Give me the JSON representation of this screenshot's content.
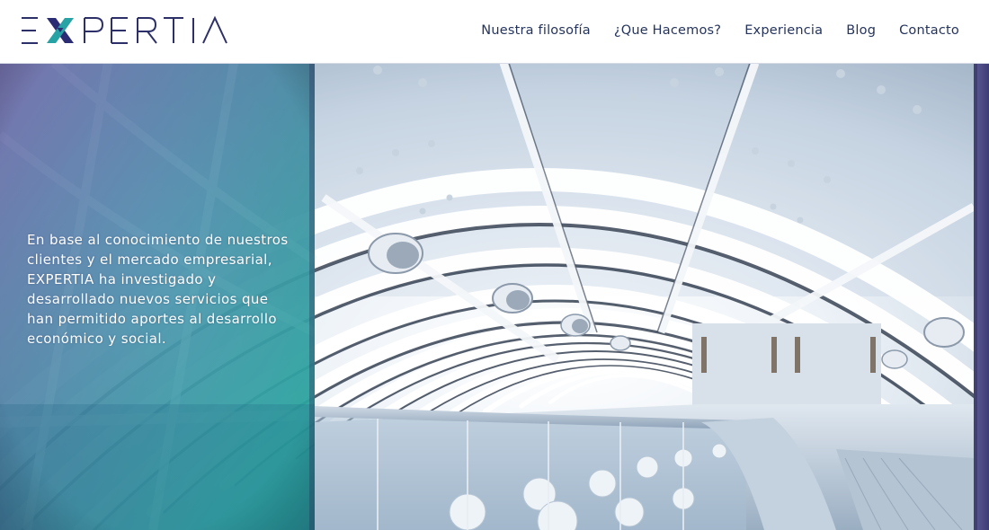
{
  "brand": {
    "name": "EXPERTIA",
    "colors": {
      "navy": "#25345d",
      "logo_x": "#2a2f7a",
      "logo_x_accent": "#27a3a6",
      "panel_teal": "#1fb3a4",
      "panel_purple": "#6d6aa8"
    }
  },
  "nav": {
    "items": [
      {
        "label": "Nuestra filosofía"
      },
      {
        "label": "¿Que Hacemos?"
      },
      {
        "label": "Experiencia"
      },
      {
        "label": "Blog"
      },
      {
        "label": "Contacto"
      }
    ]
  },
  "hero": {
    "text": "En base al conocimiento de nuestros clientes y el mercado empresarial, EXPERTIA ha investigado y desarrollado nuevos servicios que han permitido aportes al desarrollo económico y social.",
    "image_subject": "glass-tunnel-escalator"
  }
}
